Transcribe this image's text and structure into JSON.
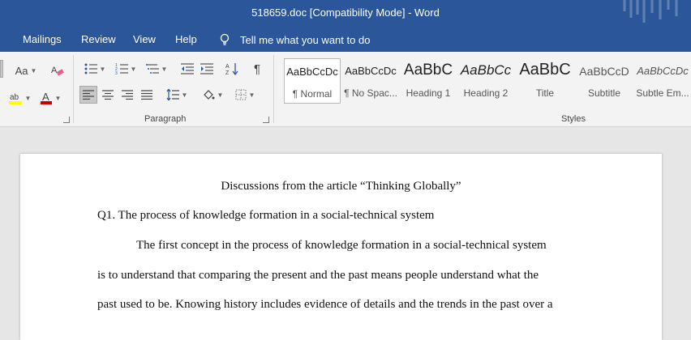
{
  "titlebar": {
    "title": "518659.doc [Compatibility Mode]  -  Word"
  },
  "tabs": [
    "Mailings",
    "Review",
    "View",
    "Help"
  ],
  "tellme": {
    "label": "Tell me what you want to do"
  },
  "ribbon": {
    "font_group": {
      "font_size_label": "Aa"
    },
    "paragraph_group": {
      "label": "Paragraph"
    },
    "styles_group": {
      "label": "Styles"
    },
    "styles": [
      {
        "preview": "AaBbCcDc",
        "name": "¶ Normal",
        "selected": true
      },
      {
        "preview": "AaBbCcDc",
        "name": "¶ No Spac..."
      },
      {
        "preview": "AaBbC",
        "name": "Heading 1"
      },
      {
        "preview": "AaBbCc",
        "name": "Heading 2"
      },
      {
        "preview": "AaBbC",
        "name": "Title"
      },
      {
        "preview": "AaBbCcD",
        "name": "Subtitle"
      },
      {
        "preview": "AaBbCcDc",
        "name": "Subtle Em..."
      }
    ]
  },
  "document": {
    "title": "Discussions from the article “Thinking Globally”",
    "question": "Q1. The process of knowledge formation in a social-technical system",
    "lines": [
      "The first concept in the process of knowledge formation in a social-technical system",
      "is to understand that comparing the present and the past means people understand what the",
      "past used to be. Knowing history includes evidence of details and the trends in the past over a"
    ]
  },
  "colors": {
    "accent": "#2b579a",
    "highlight": "#ffff00",
    "font_color": "#d00000"
  }
}
